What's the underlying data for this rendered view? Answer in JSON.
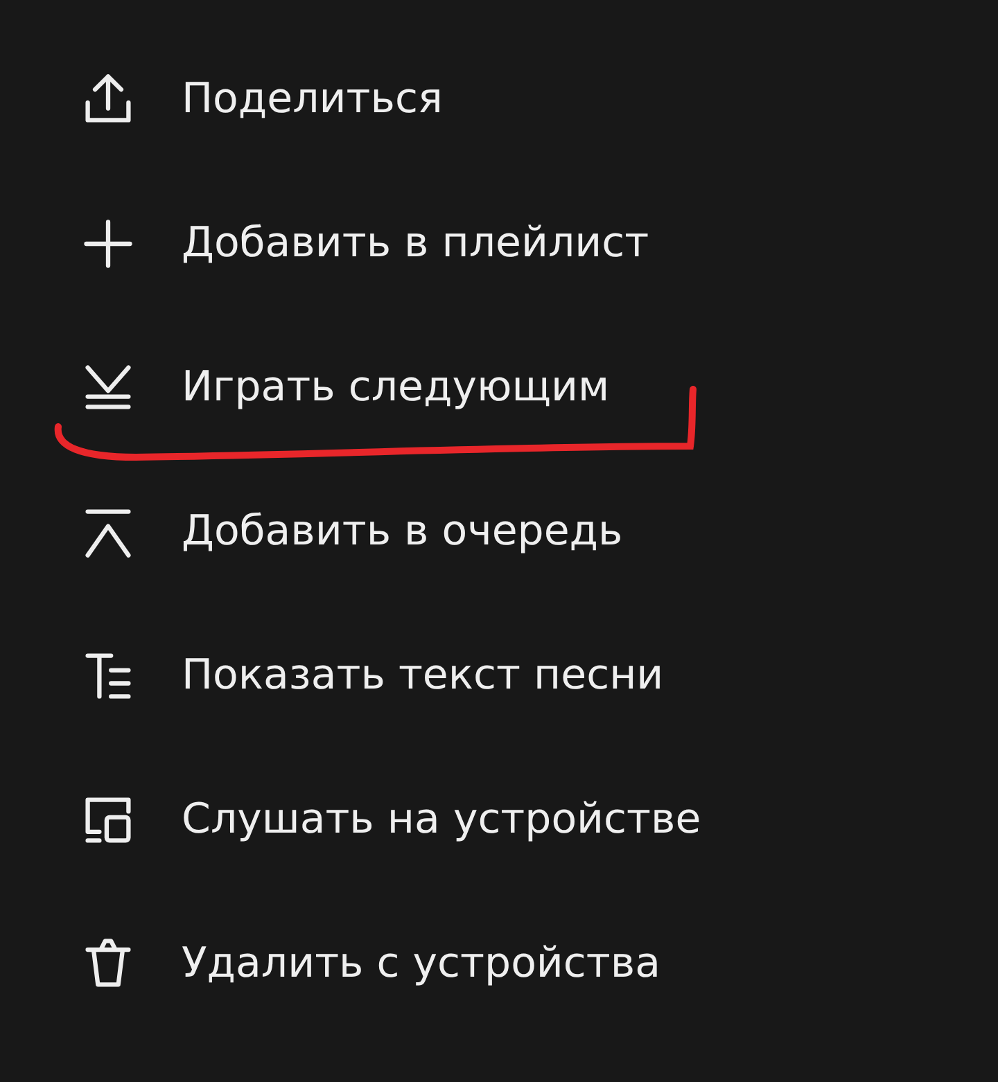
{
  "menu": {
    "items": [
      {
        "label": "Поделиться",
        "underlined": false
      },
      {
        "label": "Добавить в плейлист",
        "underlined": false
      },
      {
        "label": "Играть следующим",
        "underlined": true
      },
      {
        "label": "Добавить в очередь",
        "underlined": false
      },
      {
        "label": "Показать текст песни",
        "underlined": false
      },
      {
        "label": "Слушать на устройстве",
        "underlined": false
      },
      {
        "label": "Удалить с устройства",
        "underlined": false
      }
    ]
  }
}
